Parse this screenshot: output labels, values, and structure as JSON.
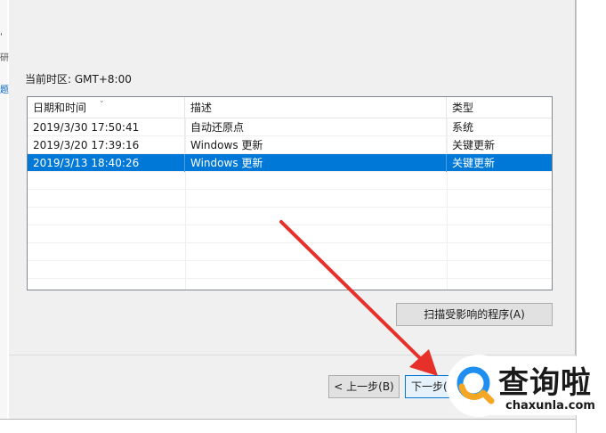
{
  "edge_glyphs": [
    "'",
    "研",
    "题"
  ],
  "timezone_label": "当前时区: GMT+8:00",
  "list": {
    "columns": [
      "日期和时间",
      "描述",
      "类型"
    ],
    "sort_indicator": "⌄",
    "rows": [
      {
        "datetime": "2019/3/30 17:50:41",
        "description": "自动还原点",
        "type": "系统",
        "selected": false
      },
      {
        "datetime": "2019/3/20 17:39:16",
        "description": "Windows 更新",
        "type": "关键更新",
        "selected": false
      },
      {
        "datetime": "2019/3/13 18:40:26",
        "description": "Windows 更新",
        "type": "关键更新",
        "selected": true
      }
    ]
  },
  "buttons": {
    "scan": "扫描受影响的程序(A)",
    "back": "< 上一步(B)",
    "next": "下一步("
  },
  "watermark": {
    "text": "查询啦",
    "domain": "chaxunla.com",
    "colors": {
      "blue": "#1f8ef1",
      "orange": "#f5a623"
    }
  },
  "annotation": {
    "color": "#e8302a"
  },
  "accent": "#0078d7"
}
